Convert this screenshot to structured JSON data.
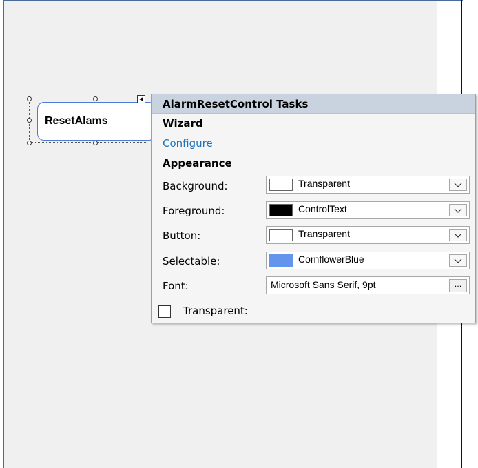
{
  "control": {
    "button_text": "ResetAlams"
  },
  "panel": {
    "title": "AlarmResetControl Tasks",
    "wizard_section": "Wizard",
    "configure_link": "Configure",
    "appearance_section": "Appearance",
    "properties": [
      {
        "label": "Background:",
        "value": "Transparent",
        "swatch_color": "#ffffff"
      },
      {
        "label": "Foreground:",
        "value": "ControlText",
        "swatch_color": "#000000"
      },
      {
        "label": "Button:",
        "value": "Transparent",
        "swatch_color": "#ffffff"
      },
      {
        "label": "Selectable:",
        "value": "CornflowerBlue",
        "swatch_color": "#6495ed"
      }
    ],
    "font": {
      "label": "Font:",
      "value": "Microsoft Sans Serif, 9pt",
      "button_label": "..."
    },
    "transparent_checkbox": {
      "label": "Transparent:",
      "checked": false
    }
  },
  "colors": {
    "accent_link": "#1e73be",
    "header_bg": "#c9d3df",
    "button_border": "#4b7bd4"
  },
  "icons": {
    "dropdown": "chevron-down-icon",
    "smart_tag": "smart-tag-arrow-icon"
  }
}
